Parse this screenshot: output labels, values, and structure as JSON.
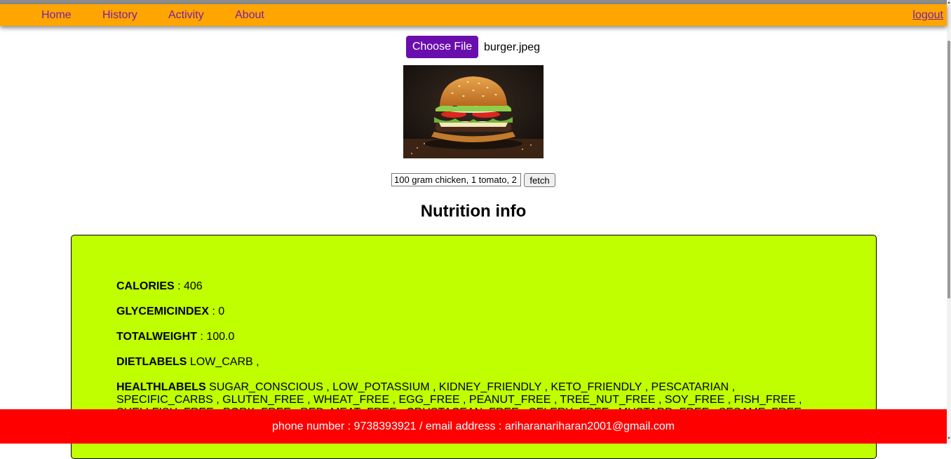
{
  "nav": {
    "links": [
      "Home",
      "History",
      "Activity",
      "About"
    ],
    "logout": "logout"
  },
  "upload": {
    "button_label": "Choose File",
    "file_name": "burger.jpeg"
  },
  "query": {
    "value": "100 gram chicken, 1 tomato, 2",
    "fetch_label": "fetch"
  },
  "nutrition": {
    "title": "Nutrition info",
    "calories_label": "CALORIES",
    "calories_value": " : 406",
    "glycemic_label": "GLYCEMICINDEX",
    "glycemic_value": " : 0",
    "weight_label": "TOTALWEIGHT",
    "weight_value": " : 100.0",
    "diet_label": "DIETLABELS",
    "diet_value": " LOW_CARB ,",
    "health_label": "HEALTHLABELS",
    "health_value": " SUGAR_CONSCIOUS , LOW_POTASSIUM , KIDNEY_FRIENDLY , KETO_FRIENDLY , PESCATARIAN , SPECIFIC_CARBS , GLUTEN_FREE , WHEAT_FREE , EGG_FREE , PEANUT_FREE , TREE_NUT_FREE , SOY_FREE , FISH_FREE , SHELLFISH_FREE , PORK_FREE , RED_MEAT_FREE , CRUSTACEAN_FREE , CELERY_FREE , MUSTARD_FREE , SESAME_FREE ,"
  },
  "footer": {
    "text": "phone number : 9738393921 / email address : ariharanariharan2001@gmail.com"
  },
  "colors": {
    "navbar": "#ffa500",
    "nav_link": "#7a1fa2",
    "file_button": "#6a0dad",
    "nutrition_box": "#bfff00",
    "footer": "#ff0000"
  },
  "icons": {
    "scroll_up": "triangle-up",
    "scroll_down": "triangle-down"
  }
}
